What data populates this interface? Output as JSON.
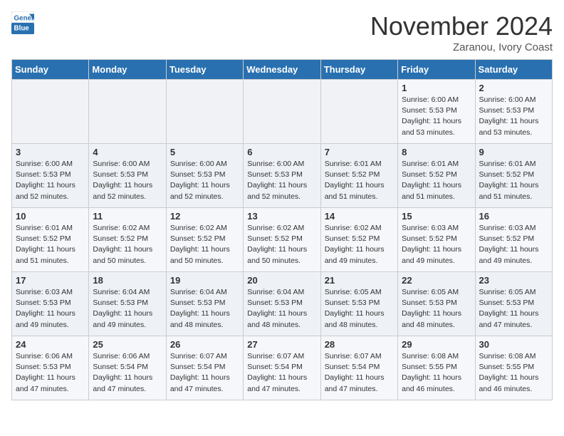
{
  "header": {
    "logo_line1": "General",
    "logo_line2": "Blue",
    "month": "November 2024",
    "location": "Zaranou, Ivory Coast"
  },
  "days_of_week": [
    "Sunday",
    "Monday",
    "Tuesday",
    "Wednesday",
    "Thursday",
    "Friday",
    "Saturday"
  ],
  "weeks": [
    [
      {
        "day": "",
        "info": ""
      },
      {
        "day": "",
        "info": ""
      },
      {
        "day": "",
        "info": ""
      },
      {
        "day": "",
        "info": ""
      },
      {
        "day": "",
        "info": ""
      },
      {
        "day": "1",
        "info": "Sunrise: 6:00 AM\nSunset: 5:53 PM\nDaylight: 11 hours\nand 53 minutes."
      },
      {
        "day": "2",
        "info": "Sunrise: 6:00 AM\nSunset: 5:53 PM\nDaylight: 11 hours\nand 53 minutes."
      }
    ],
    [
      {
        "day": "3",
        "info": "Sunrise: 6:00 AM\nSunset: 5:53 PM\nDaylight: 11 hours\nand 52 minutes."
      },
      {
        "day": "4",
        "info": "Sunrise: 6:00 AM\nSunset: 5:53 PM\nDaylight: 11 hours\nand 52 minutes."
      },
      {
        "day": "5",
        "info": "Sunrise: 6:00 AM\nSunset: 5:53 PM\nDaylight: 11 hours\nand 52 minutes."
      },
      {
        "day": "6",
        "info": "Sunrise: 6:00 AM\nSunset: 5:53 PM\nDaylight: 11 hours\nand 52 minutes."
      },
      {
        "day": "7",
        "info": "Sunrise: 6:01 AM\nSunset: 5:52 PM\nDaylight: 11 hours\nand 51 minutes."
      },
      {
        "day": "8",
        "info": "Sunrise: 6:01 AM\nSunset: 5:52 PM\nDaylight: 11 hours\nand 51 minutes."
      },
      {
        "day": "9",
        "info": "Sunrise: 6:01 AM\nSunset: 5:52 PM\nDaylight: 11 hours\nand 51 minutes."
      }
    ],
    [
      {
        "day": "10",
        "info": "Sunrise: 6:01 AM\nSunset: 5:52 PM\nDaylight: 11 hours\nand 51 minutes."
      },
      {
        "day": "11",
        "info": "Sunrise: 6:02 AM\nSunset: 5:52 PM\nDaylight: 11 hours\nand 50 minutes."
      },
      {
        "day": "12",
        "info": "Sunrise: 6:02 AM\nSunset: 5:52 PM\nDaylight: 11 hours\nand 50 minutes."
      },
      {
        "day": "13",
        "info": "Sunrise: 6:02 AM\nSunset: 5:52 PM\nDaylight: 11 hours\nand 50 minutes."
      },
      {
        "day": "14",
        "info": "Sunrise: 6:02 AM\nSunset: 5:52 PM\nDaylight: 11 hours\nand 49 minutes."
      },
      {
        "day": "15",
        "info": "Sunrise: 6:03 AM\nSunset: 5:52 PM\nDaylight: 11 hours\nand 49 minutes."
      },
      {
        "day": "16",
        "info": "Sunrise: 6:03 AM\nSunset: 5:52 PM\nDaylight: 11 hours\nand 49 minutes."
      }
    ],
    [
      {
        "day": "17",
        "info": "Sunrise: 6:03 AM\nSunset: 5:53 PM\nDaylight: 11 hours\nand 49 minutes."
      },
      {
        "day": "18",
        "info": "Sunrise: 6:04 AM\nSunset: 5:53 PM\nDaylight: 11 hours\nand 49 minutes."
      },
      {
        "day": "19",
        "info": "Sunrise: 6:04 AM\nSunset: 5:53 PM\nDaylight: 11 hours\nand 48 minutes."
      },
      {
        "day": "20",
        "info": "Sunrise: 6:04 AM\nSunset: 5:53 PM\nDaylight: 11 hours\nand 48 minutes."
      },
      {
        "day": "21",
        "info": "Sunrise: 6:05 AM\nSunset: 5:53 PM\nDaylight: 11 hours\nand 48 minutes."
      },
      {
        "day": "22",
        "info": "Sunrise: 6:05 AM\nSunset: 5:53 PM\nDaylight: 11 hours\nand 48 minutes."
      },
      {
        "day": "23",
        "info": "Sunrise: 6:05 AM\nSunset: 5:53 PM\nDaylight: 11 hours\nand 47 minutes."
      }
    ],
    [
      {
        "day": "24",
        "info": "Sunrise: 6:06 AM\nSunset: 5:53 PM\nDaylight: 11 hours\nand 47 minutes."
      },
      {
        "day": "25",
        "info": "Sunrise: 6:06 AM\nSunset: 5:54 PM\nDaylight: 11 hours\nand 47 minutes."
      },
      {
        "day": "26",
        "info": "Sunrise: 6:07 AM\nSunset: 5:54 PM\nDaylight: 11 hours\nand 47 minutes."
      },
      {
        "day": "27",
        "info": "Sunrise: 6:07 AM\nSunset: 5:54 PM\nDaylight: 11 hours\nand 47 minutes."
      },
      {
        "day": "28",
        "info": "Sunrise: 6:07 AM\nSunset: 5:54 PM\nDaylight: 11 hours\nand 47 minutes."
      },
      {
        "day": "29",
        "info": "Sunrise: 6:08 AM\nSunset: 5:55 PM\nDaylight: 11 hours\nand 46 minutes."
      },
      {
        "day": "30",
        "info": "Sunrise: 6:08 AM\nSunset: 5:55 PM\nDaylight: 11 hours\nand 46 minutes."
      }
    ]
  ]
}
